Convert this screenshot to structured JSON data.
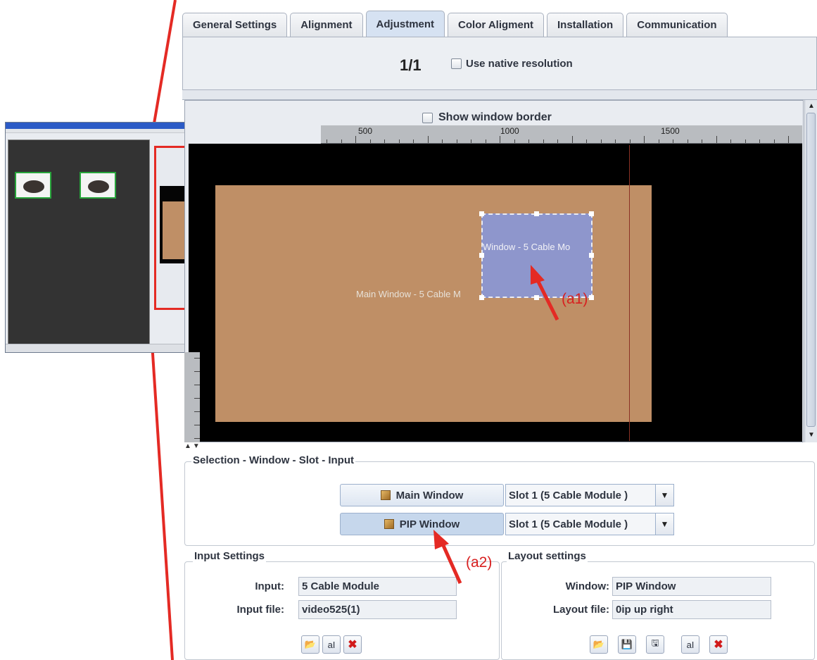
{
  "tabs": [
    {
      "label": "General Settings"
    },
    {
      "label": "Alignment"
    },
    {
      "label": "Adjustment"
    },
    {
      "label": "Color Aligment"
    },
    {
      "label": "Installation"
    },
    {
      "label": "Communication"
    }
  ],
  "active_tab": "Adjustment",
  "page_indicator": "1/1",
  "native_resolution_label": "Use native resolution",
  "show_border_label": "Show window border",
  "ruler": {
    "marks": [
      "500",
      "1000",
      "1500"
    ]
  },
  "canvas": {
    "pip_window_label": "Window - 5 Cable Mo",
    "main_window_label": "Main Window - 5 Cable M",
    "colors": {
      "background": "#000000",
      "main_window": "#bf8f66",
      "pip_window": "#8e96cc"
    }
  },
  "selection": {
    "title": "Selection - Window - Slot - Input",
    "windows": [
      {
        "name": "Main Window",
        "slot": "Slot 1 (5 Cable Module )"
      },
      {
        "name": "PIP Window",
        "slot": "Slot 1 (5 Cable Module )"
      }
    ]
  },
  "input_settings": {
    "title": "Input Settings",
    "input_label": "Input:",
    "input_value": "5 Cable Module",
    "file_label": "Input file:",
    "file_value": "video525(1)"
  },
  "layout_settings": {
    "title": "Layout settings",
    "window_label": "Window:",
    "window_value": "PIP Window",
    "file_label": "Layout file:",
    "file_value": "0ip up right"
  },
  "annotations": {
    "a1": "(a1)",
    "a2": "(a2)"
  },
  "icons": {
    "open": "folder-open-icon",
    "save": "save-icon",
    "save_as": "save-as-icon",
    "rename": "rename-icon",
    "delete": "delete-icon"
  }
}
